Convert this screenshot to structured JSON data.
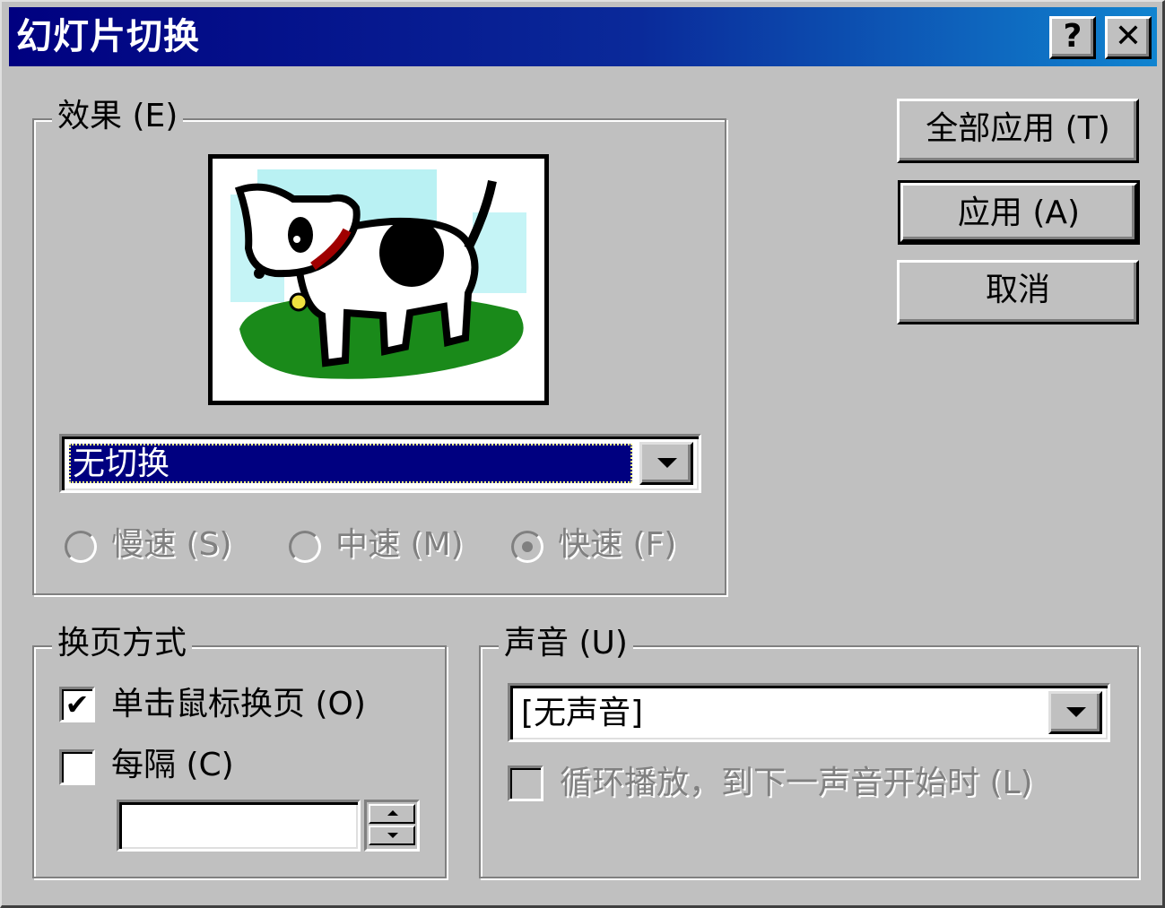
{
  "window": {
    "title": "幻灯片切换",
    "help_label": "?",
    "close_label": "✕"
  },
  "effect": {
    "group_label": "效果 (E)",
    "transition_value": "无切换",
    "speeds": [
      {
        "label": "慢速 (S)",
        "selected": false
      },
      {
        "label": "中速 (M)",
        "selected": false
      },
      {
        "label": "快速 (F)",
        "selected": true
      }
    ]
  },
  "buttons": {
    "apply_all": "全部应用 (T)",
    "apply": "应用 (A)",
    "cancel": "取消"
  },
  "advance": {
    "group_label": "换页方式",
    "on_click_label": "单击鼠标换页 (O)",
    "on_click_checked": "✔",
    "every_label": "每隔 (C)",
    "every_value": ""
  },
  "sound": {
    "group_label": "声音 (U)",
    "value": "[无声音]",
    "loop_label": "循环播放，到下一声音开始时 (L)"
  },
  "colors": {
    "title_start": "#000080",
    "title_end": "#1084d0",
    "selection": "#000080",
    "face": "#c0c0c0"
  }
}
